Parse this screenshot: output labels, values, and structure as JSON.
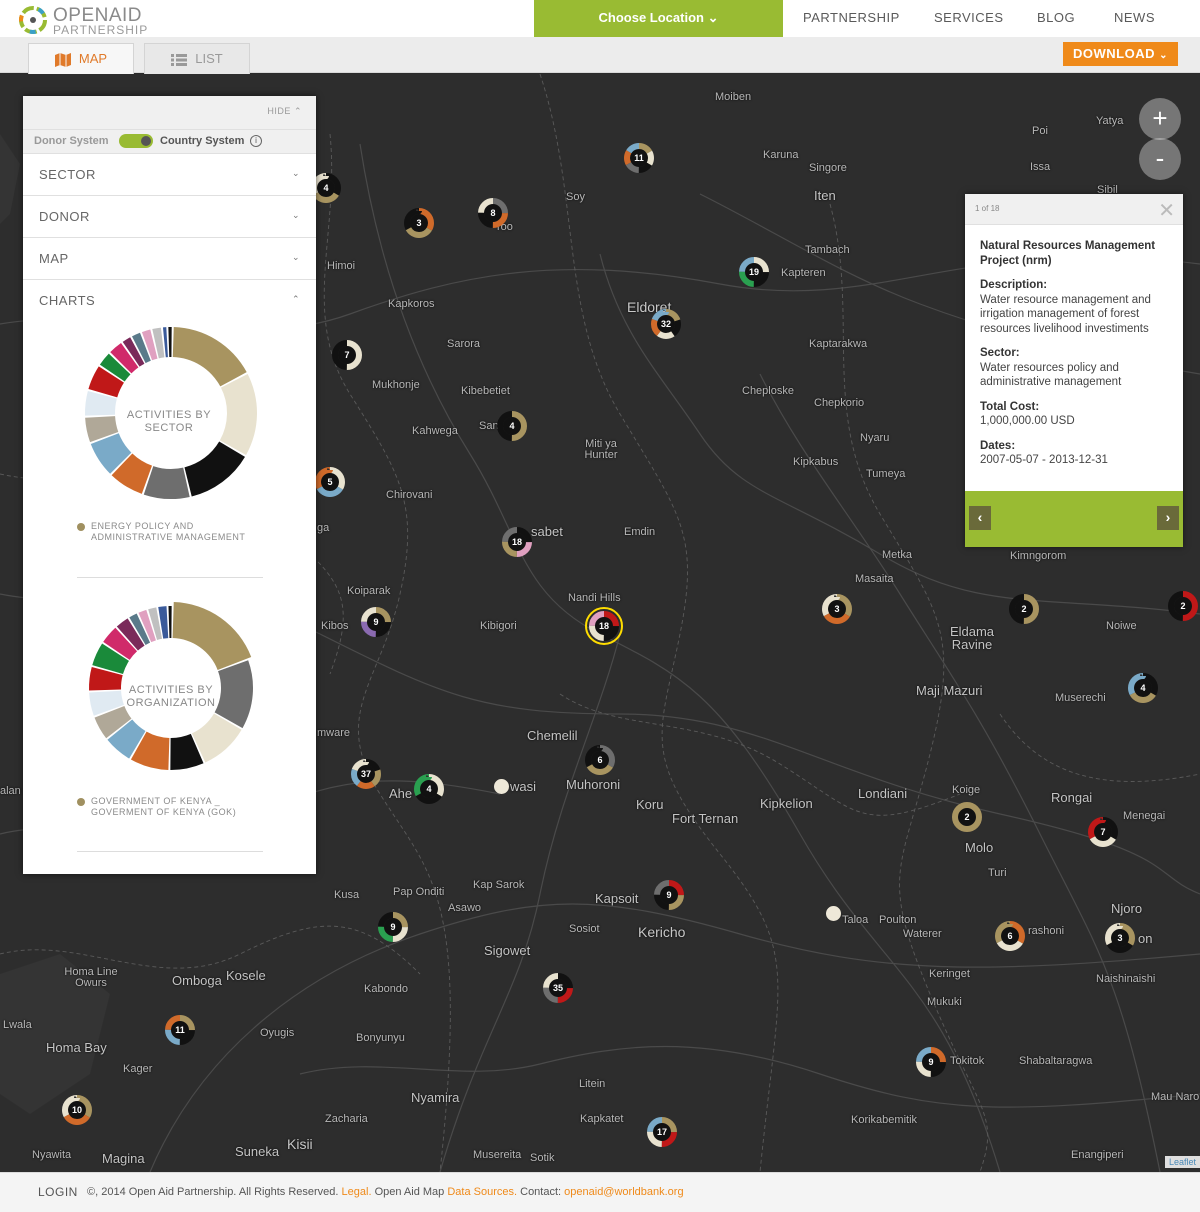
{
  "header": {
    "logo_line1": "OPENAID",
    "logo_line2": "PARTNERSHIP",
    "choose_location": "Choose Location",
    "nav": [
      "PARTNERSHIP",
      "SERVICES",
      "BLOG",
      "NEWS"
    ]
  },
  "tabs": {
    "map": "MAP",
    "list": "LIST",
    "download": "DOWNLOAD"
  },
  "panel": {
    "hide": "HIDE",
    "donor_system": "Donor System",
    "country_system": "Country System",
    "sections": [
      "SECTOR",
      "DONOR",
      "MAP",
      "CHARTS"
    ],
    "chart1_center": [
      "ACTIVITIES BY",
      "SECTOR"
    ],
    "chart1_legend": [
      "ENERGY POLICY AND",
      "ADMINISTRATIVE MANAGEMENT"
    ],
    "chart2_center": [
      "ACTIVITIES BY",
      "ORGANIZATION"
    ],
    "chart2_legend": [
      "GOVERNMENT OF KENYA _",
      "GOVERMENT OF KENYA (GOK)"
    ]
  },
  "chart_data": [
    {
      "type": "pie",
      "title": "ACTIVITIES BY SECTOR",
      "categories": [
        "Energy policy and administrative management"
      ],
      "values": []
    },
    {
      "type": "pie",
      "title": "ACTIVITIES BY ORGANIZATION",
      "categories": [
        "Government of Kenya _ Goverment of Kenya (GOK)"
      ],
      "values": []
    }
  ],
  "popup": {
    "counter": "1 of 18",
    "title": "Natural Resources Management Project (nrm)",
    "description_label": "Description:",
    "description": "Water resource management and irrigation management of forest resources livelihood investiments",
    "sector_label": "Sector:",
    "sector": "Water resources policy and administrative management",
    "cost_label": "Total Cost:",
    "cost": "1,000,000.00 USD",
    "dates_label": "Dates:",
    "dates": "2007-05-07 - 2013-12-31"
  },
  "zoom": {
    "in": "+",
    "out": "-"
  },
  "clusters": [
    "11",
    "4",
    "3",
    "8",
    "19",
    "32",
    "7",
    "4",
    "5",
    "18",
    "18",
    "9",
    "3",
    "2",
    "2",
    "4",
    "6",
    "37",
    "4",
    "7",
    "2",
    "9",
    "9",
    "6",
    "3",
    "35",
    "11",
    "9",
    "10",
    "17"
  ],
  "places": [
    "Moiben",
    "Karuna",
    "Singore",
    "Iten",
    "Yatya",
    "Poi",
    "Issa",
    "Soy",
    "Tambach",
    "Kapteren",
    "Himoi",
    "Kapkoros",
    "Sarora",
    "Eldoret",
    "Kaptarakwa",
    "Mukhonje",
    "Kibebetiet",
    "Cheploske",
    "Chepkorio",
    "Kahwega",
    "Miti ya Hunter",
    "Nyaru",
    "Kipkabus",
    "Tumeya",
    "Chirovani",
    "Emdin",
    "Metka",
    "Kimngorom",
    "Masaita",
    "Koiparak",
    "Nandi Hills",
    "Kibos",
    "Kibigori",
    "Noiwe",
    "Eldama Ravine",
    "Maji Mazuri",
    "Muserechi",
    "Chemelil",
    "Muhoroni",
    "Koru",
    "Fort Ternan",
    "Kipkelion",
    "Londiani",
    "Rongai",
    "Menegai",
    "Koige",
    "Molo",
    "Turi",
    "Kusa",
    "Pap Onditi",
    "Kap Sarok",
    "Asawo",
    "Kapsoit",
    "Kericho",
    "Sosiot",
    "Sigowet",
    "Poulton",
    "Waterer",
    "Njoro",
    "Homa Line Owurs",
    "Omboga",
    "Kosele",
    "Kabondo",
    "Oyugis",
    "Keringet",
    "Naishinaishi",
    "Mukuki",
    "Lwala",
    "Homa Bay",
    "Bonyunyu",
    "Kager",
    "Tokitok",
    "Shabaltaragwa",
    "Litein",
    "Nyamira",
    "Zacharia",
    "Kapkatet",
    "Korikabemitik",
    "Mau Naro",
    "Kisii",
    "Suneka",
    "Magina",
    "Nyawita",
    "Sotik",
    "Musereita",
    "Enangiperi",
    "Ahe",
    "wasi",
    "Taloa",
    "rashoni",
    "on",
    "Sibil",
    "sabet",
    "San",
    "roo",
    "ga",
    "mware",
    "alan"
  ],
  "footer": {
    "login": "LOGIN",
    "copy": "©, 2014 Open Aid Partnership. All Rights Reserved.",
    "legal": "Legal.",
    "oam": "Open Aid Map",
    "sources": "Data Sources.",
    "contact": "Contact:",
    "email": "openaid@worldbank.org",
    "leaflet": "Leaflet"
  },
  "colors": {
    "accent_green": "#99bb33",
    "accent_orange": "#ef8a1a",
    "map_bg": "#2d2d2d"
  }
}
